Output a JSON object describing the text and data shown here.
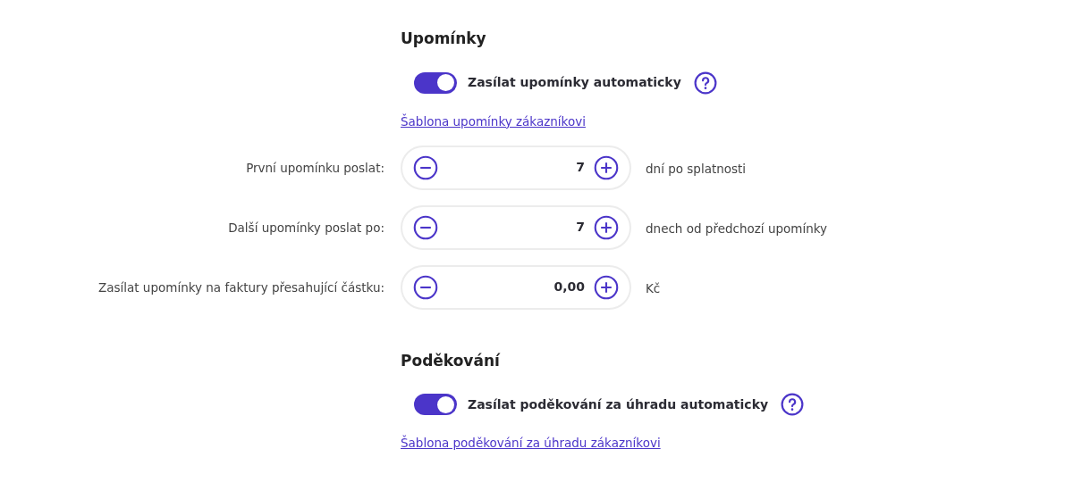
{
  "sections": [
    {
      "title": "Upomínky",
      "toggle": {
        "label": "Zasílat upomínky automaticky",
        "on": true
      },
      "link": "Šablona upomínky zákazníkovi",
      "fields": [
        {
          "label": "První upomínku poslat:",
          "value": "7",
          "unit": "dní po splatnosti"
        },
        {
          "label": "Další upomínky poslat po:",
          "value": "7",
          "unit": "dnech od předchozí upomínky"
        },
        {
          "label": "Zasílat upomínky na faktury přesahující částku:",
          "value": "0,00",
          "unit": "Kč"
        }
      ]
    },
    {
      "title": "Poděkování",
      "toggle": {
        "label": "Zasílat poděkování za úhradu automaticky",
        "on": true
      },
      "link": "Šablona poděkování za úhradu zákazníkovi"
    }
  ]
}
